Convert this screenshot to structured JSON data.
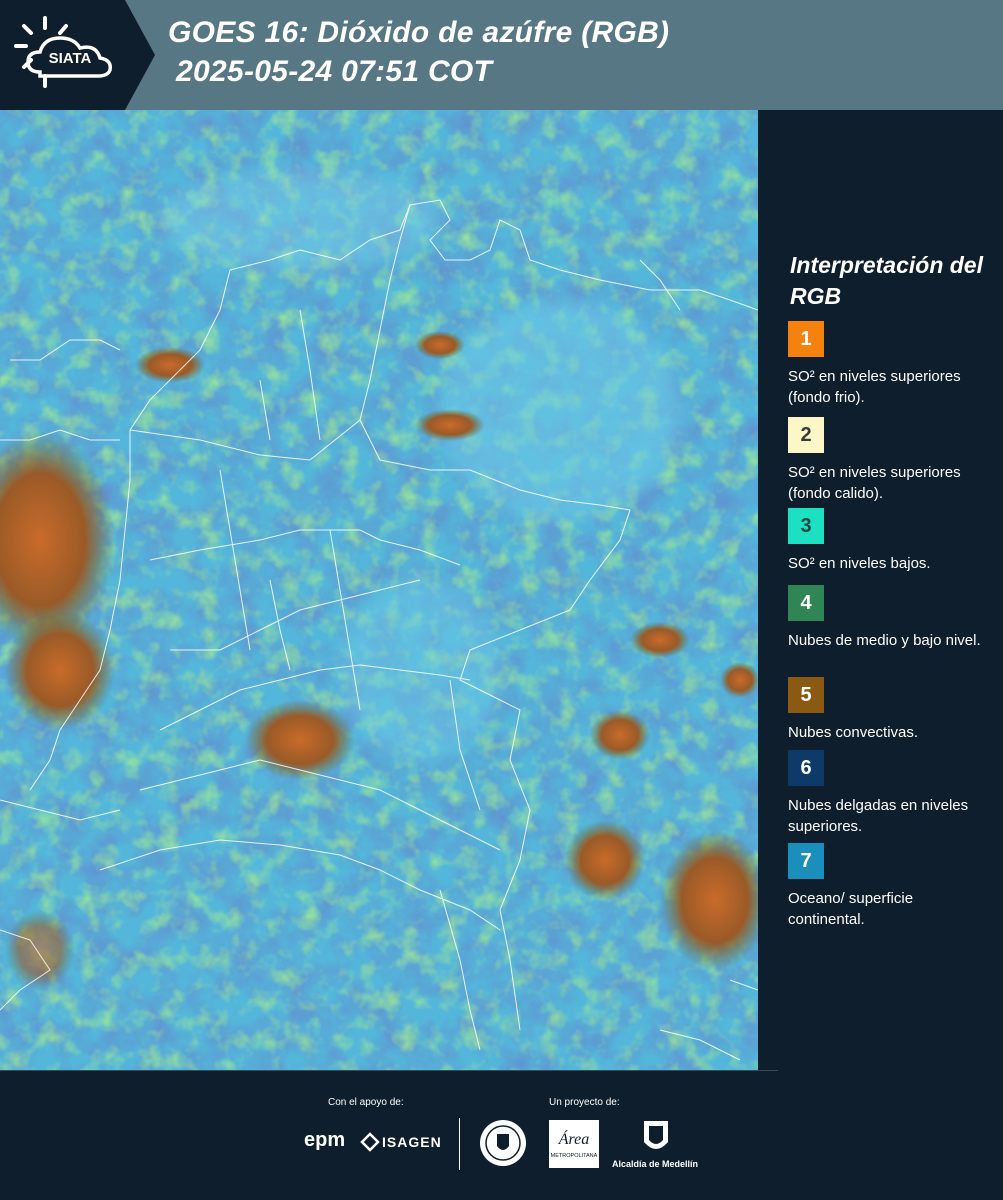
{
  "header": {
    "logo_text": "SIATA",
    "title_line1": "GOES 16: Dióxido de azúfre (RGB)",
    "title_line2": "2025-05-24 07:51 COT",
    "colors": {
      "background": "#587784",
      "logo_background": "#0e1e2c"
    }
  },
  "legend": {
    "title": "Interpretación del RGB",
    "items": [
      {
        "number": "1",
        "color": "#f5820f",
        "text_color": "#ffffff",
        "label": "SO² en niveles superiores (fondo frio)."
      },
      {
        "number": "2",
        "color": "#fdf7c8",
        "text_color": "#3a3a3a",
        "label": "SO² en niveles superiores (fondo calido)."
      },
      {
        "number": "3",
        "color": "#1de0c2",
        "text_color": "#1b4a44",
        "label": "SO² en niveles bajos."
      },
      {
        "number": "4",
        "color": "#2f8654",
        "text_color": "#ffffff",
        "label": "Nubes de medio y bajo nivel."
      },
      {
        "number": "5",
        "color": "#8a5a12",
        "text_color": "#ffffff",
        "label": "Nubes convectivas."
      },
      {
        "number": "6",
        "color": "#0e3a6a",
        "text_color": "#ffffff",
        "label": "Nubes delgadas en niveles superiores."
      },
      {
        "number": "7",
        "color": "#1a8fbc",
        "text_color": "#ffffff",
        "label": "Oceano/ superficie continental."
      }
    ]
  },
  "map": {
    "icon": "satellite-map",
    "colors": {
      "base": "#4fb3d9",
      "dark": "#1f4f9a",
      "green": "#5fd64a",
      "convective": "#a8642a",
      "border": "#ffffff"
    }
  },
  "footer": {
    "support_label": "Con el apoyo de:",
    "project_label": "Un proyecto de:",
    "sponsor_1": "epm",
    "sponsor_2": "ISAGEN",
    "partner_1": "Área",
    "partner_1_sub": "METROPOLITANA",
    "partner_2": "Alcaldía de Medellín"
  }
}
